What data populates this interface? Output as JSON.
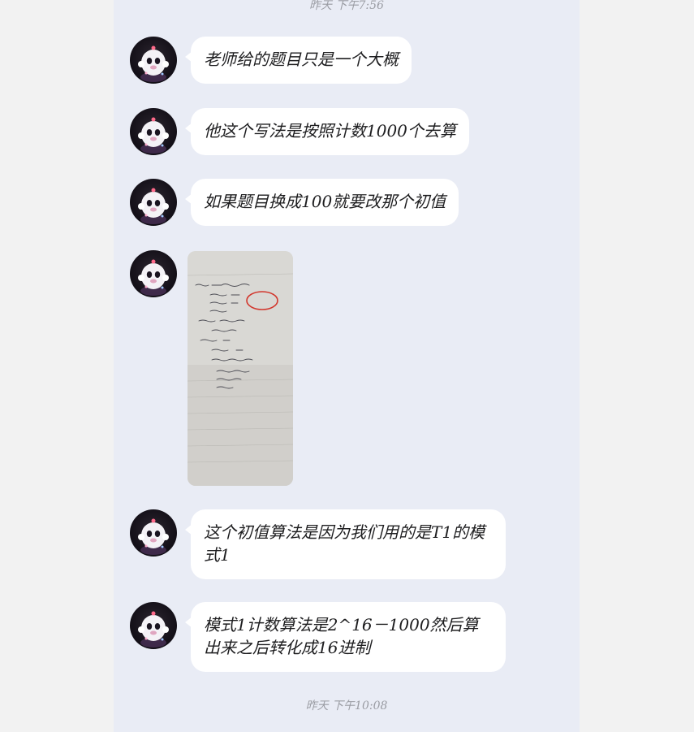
{
  "timestamps": {
    "top": "昨天 下午7:56",
    "bottom": "昨天 下午10:08"
  },
  "messages": [
    {
      "text": "老师给的题目只是一个大概"
    },
    {
      "text": "他这个写法是按照计数1000个去算"
    },
    {
      "text": "如果题目换成100就要改那个初值"
    },
    {
      "type": "image",
      "icon": "handwritten-notes-photo"
    },
    {
      "text": "这个初值算法是因为我们用的是T1的模式1"
    },
    {
      "text": "模式1计数算法是2^16－1000然后算出来之后转化成16进制"
    }
  ],
  "colors": {
    "chat_background": "#e9ecf5",
    "bubble": "#ffffff",
    "page_background": "#f2f2f2",
    "timestamp": "#9a9ca3"
  }
}
